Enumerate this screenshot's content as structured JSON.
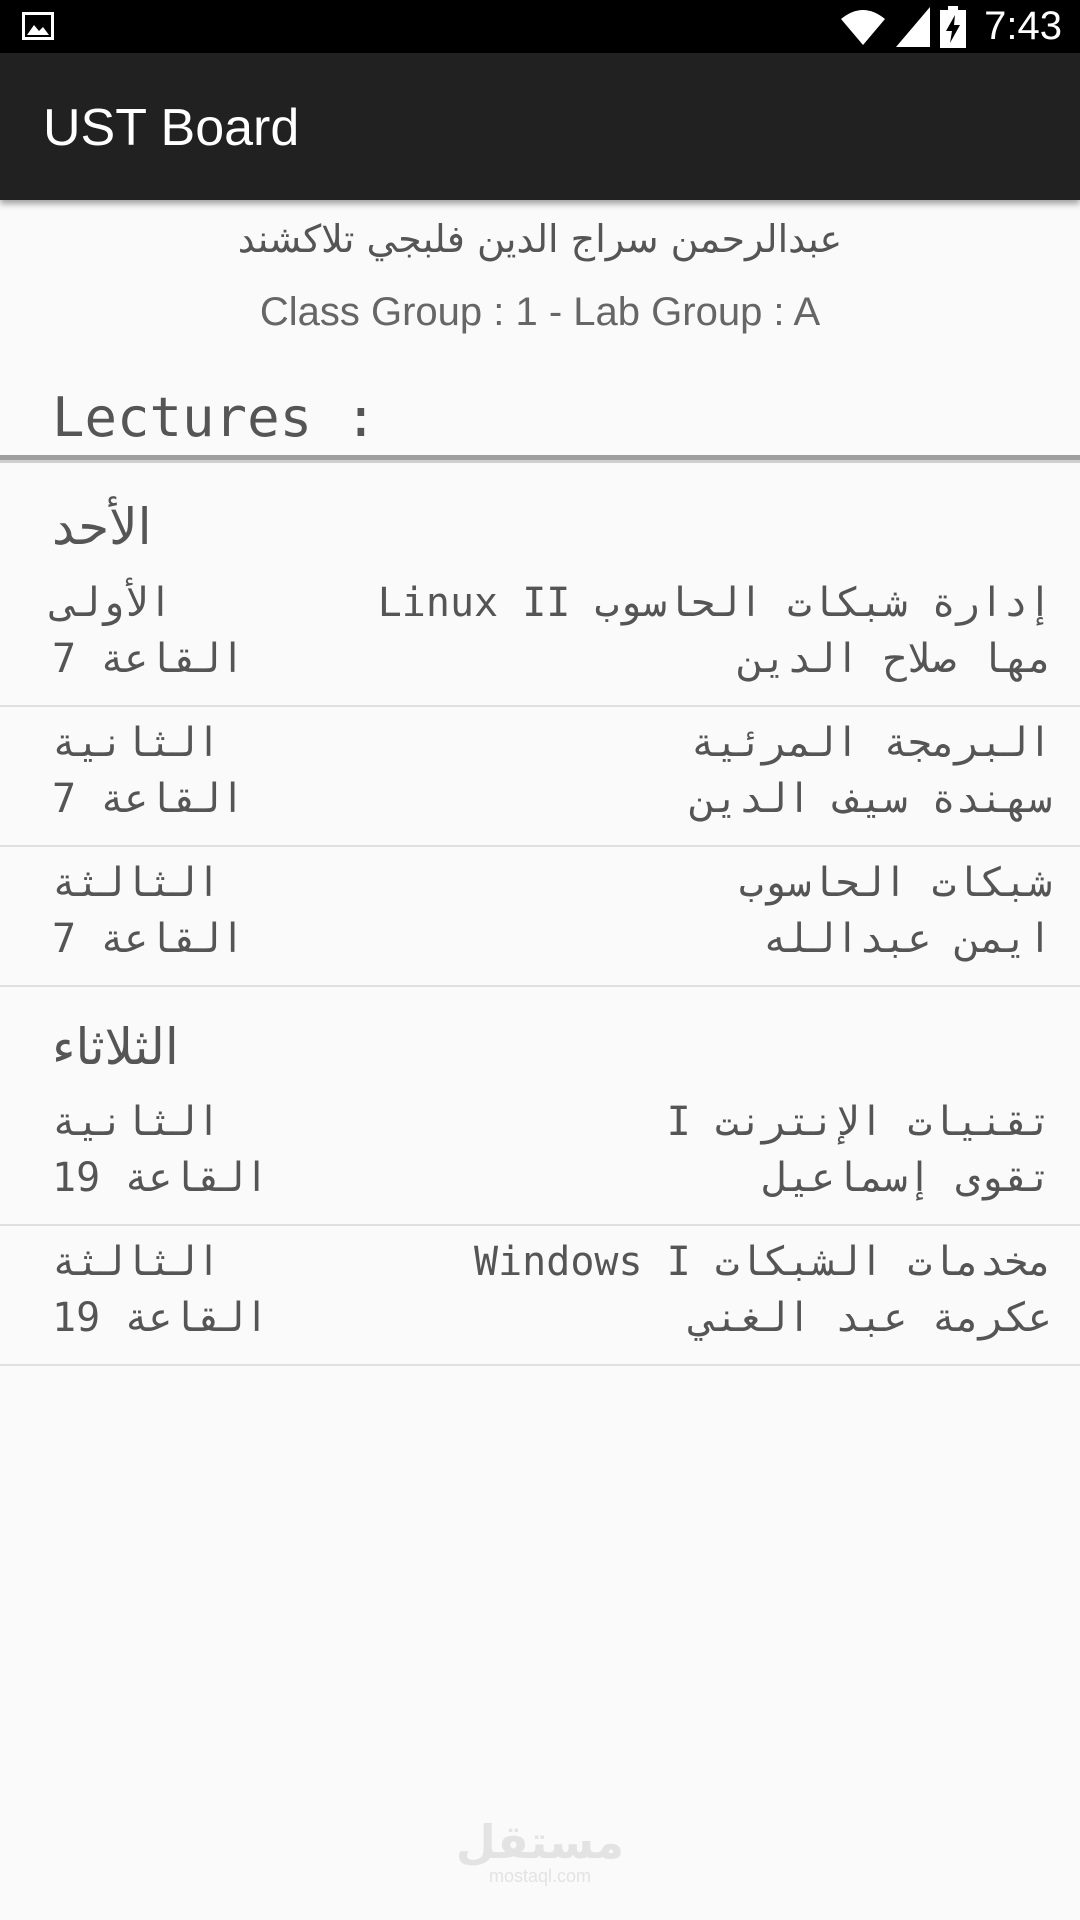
{
  "status_bar": {
    "time": "7:43",
    "icons": [
      "gallery-icon",
      "wifi-icon",
      "signal-icon",
      "battery-charging-icon"
    ]
  },
  "app_bar": {
    "title": "UST Board"
  },
  "student": {
    "name": "عبدالرحمن سراج الدين فلبجي تلاكشند",
    "group_info": "Class Group : 1 - Lab Group : A"
  },
  "section": {
    "title": "Lectures :"
  },
  "days": [
    {
      "name": "الأحد",
      "lectures": [
        {
          "course": "إدارة شبكات الحاسوب Linux II",
          "teacher": "مها صلاح الدين",
          "period": "الأولى",
          "room": "القاعة 7"
        },
        {
          "course": "البرمجة المرئية",
          "teacher": "سهندة سيف الدين",
          "period": "الثانية",
          "room": "القاعة 7"
        },
        {
          "course": "شبكات الحاسوب",
          "teacher": "ايمن عبدالله",
          "period": "الثالثة",
          "room": "القاعة 7"
        }
      ]
    },
    {
      "name": "الثلاثاء",
      "lectures": [
        {
          "course": "تقنيات الإنترنت I",
          "teacher": "تقوى إسماعيل",
          "period": "الثانية",
          "room": "القاعة 19"
        },
        {
          "course": "مخدمات الشبكات Windows I",
          "teacher": "عكرمة عبد الغني",
          "period": "الثالثة",
          "room": "القاعة 19"
        }
      ]
    }
  ],
  "watermark": {
    "main": "مستقل",
    "sub": "mostaql.com"
  },
  "colors": {
    "status_bar": "#000000",
    "app_bar": "#212121",
    "background": "#fafafa",
    "text": "#555555",
    "divider": "#e0e0e0"
  }
}
